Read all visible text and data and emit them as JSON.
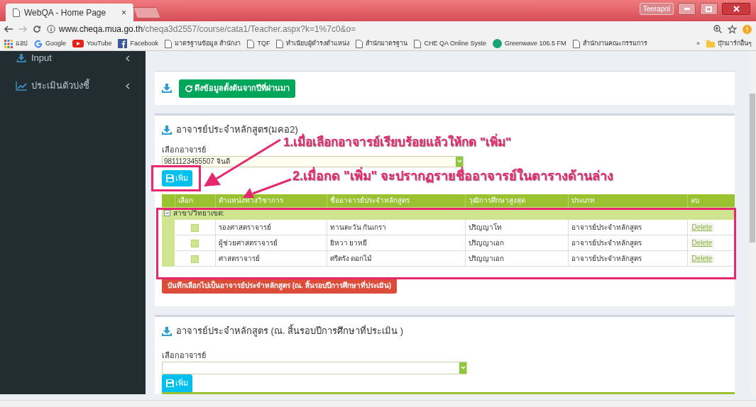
{
  "browser": {
    "tab_title": "WebQA - Home Page",
    "tab_close": "×",
    "profile": "Teerapol",
    "url_host": "www.cheqa.mua.go.th",
    "url_path": "/cheqa3d2557/course/cata1/Teacher.aspx?k=1%7c0&o=",
    "bookmarks": [
      {
        "kind": "apps",
        "label": "แอป"
      },
      {
        "kind": "google",
        "label": "Google"
      },
      {
        "kind": "youtube",
        "label": "YouTube"
      },
      {
        "kind": "facebook",
        "label": "Facebook"
      },
      {
        "kind": "page",
        "label": "มาตรฐานข้อมูล สำนักงา"
      },
      {
        "kind": "page",
        "label": "TQF"
      },
      {
        "kind": "page",
        "label": "ทำเนียบผู้ดำรงตำแหน่ง"
      },
      {
        "kind": "page",
        "label": "สำนักมาตรฐาน"
      },
      {
        "kind": "page",
        "label": "CHE QA Online Syste"
      },
      {
        "kind": "radio",
        "label": "Greenwave 106.5 FM"
      },
      {
        "kind": "page",
        "label": "สำนักงานคณะกรรมการ"
      }
    ],
    "more": "»",
    "other_bookmarks": "บุ๊กมาร์กอื่นๆ"
  },
  "sidebar": {
    "items": [
      {
        "kind": "input",
        "label": "Input",
        "expanded": false
      },
      {
        "kind": "chart",
        "label": "ประเมินตัวบ่งชี้",
        "expanded": false
      }
    ]
  },
  "copy_button": "ดึงข้อมูลตั้งต้นจากปีที่ผ่านมา",
  "section1": {
    "title": "อาจารย์ประจำหลักสูตร(มคอ2)",
    "select_label": "เลือกอาจารย์",
    "select_value": "9811123455507 จินดี",
    "add_button": "เพิ่ม",
    "table": {
      "columns": [
        "เลือก",
        "ตำแหน่งทางวิชาการ",
        "ชื่ออาจารย์ประจำหลักสูตร",
        "วุฒิการศึกษาสูงสุด",
        "ประเภท",
        "ลบ"
      ],
      "group": {
        "label": "สาขา/วิทยาเขต:",
        "expanded": true
      },
      "rows": [
        {
          "checked": false,
          "position": "รองศาสตราจารย์",
          "name": "ทานตะวัน กันเกรา",
          "degree": "ปริญญาโท",
          "type": "อาจารย์ประจำหลักสูตร",
          "action": "Delete"
        },
        {
          "checked": false,
          "position": "ผู้ช่วยศาสตราจารย์",
          "name": "ยิหวา ยาหยี",
          "degree": "ปริญญาเอก",
          "type": "อาจารย์ประจำหลักสูตร",
          "action": "Delete"
        },
        {
          "checked": false,
          "position": "ศาสตราจารย์",
          "name": "ศรีตรัง ดอกไม้",
          "degree": "ปริญญาเอก",
          "type": "อาจารย์ประจำหลักสูตร",
          "action": "Delete"
        }
      ]
    },
    "save_button": "บันทึกเลือกไปเป็นอาจารย์ประจำหลักสูตร (ณ. สิ้นรอบปีการศึกษาที่ประเมิน)"
  },
  "section2": {
    "title": "อาจารย์ประจำหลักสูตร (ณ. สิ้นรอบปีการศึกษาที่ประเมิน )",
    "select_label": "เลือกอาจารย์",
    "add_button": "เพิ่ม"
  },
  "annotations": [
    "1.เมื่อเลือกอาจารย์เรียบร้อยแล้วให้กด \"เพิ่ม\"",
    "2.เมื่อกด \"เพิ่ม\" จะปรากฏรายชื่ออาจารย์ในตารางด้านล่าง"
  ]
}
